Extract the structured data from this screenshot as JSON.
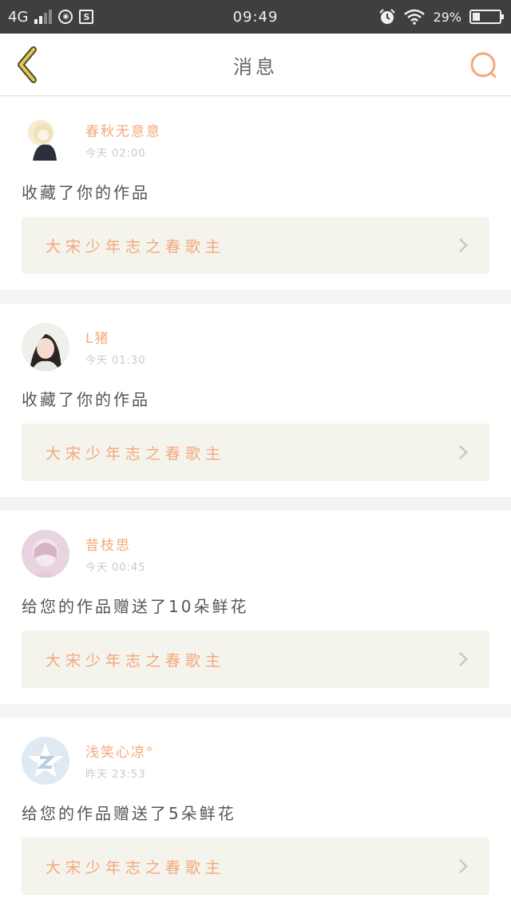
{
  "status_bar": {
    "network": "4G",
    "time": "09:49",
    "battery": "29%",
    "battery_fraction": 0.29,
    "icons": [
      "signal-icon",
      "data-saver-icon",
      "sim-icon",
      "alarm-icon",
      "wifi-icon",
      "battery-icon"
    ]
  },
  "nav": {
    "title": "消息",
    "back_icon": "chevron-left-icon",
    "search_icon": "search-icon",
    "accent": "#f4a77c",
    "back_color": "#e8c84a"
  },
  "messages": [
    {
      "user_name": "春秋无意意",
      "time": "今天 02:00",
      "action": "收藏了你的作品",
      "work_title": "大宋少年志之春歌主",
      "avatar": "avatar-anime"
    },
    {
      "user_name": "L猪",
      "time": "今天 01:30",
      "action": "收藏了你的作品",
      "work_title": "大宋少年志之春歌主",
      "avatar": "avatar-girl"
    },
    {
      "user_name": "昔枝思",
      "time": "今天 00:45",
      "action": "给您的作品赠送了10朵鲜花",
      "work_title": "大宋少年志之春歌主",
      "avatar": "avatar-pink"
    },
    {
      "user_name": "浅笑心凉°",
      "time": "昨天 23:53",
      "action": "给您的作品赠送了5朵鲜花",
      "work_title": "大宋少年志之春歌主",
      "avatar": "avatar-qzone"
    }
  ]
}
